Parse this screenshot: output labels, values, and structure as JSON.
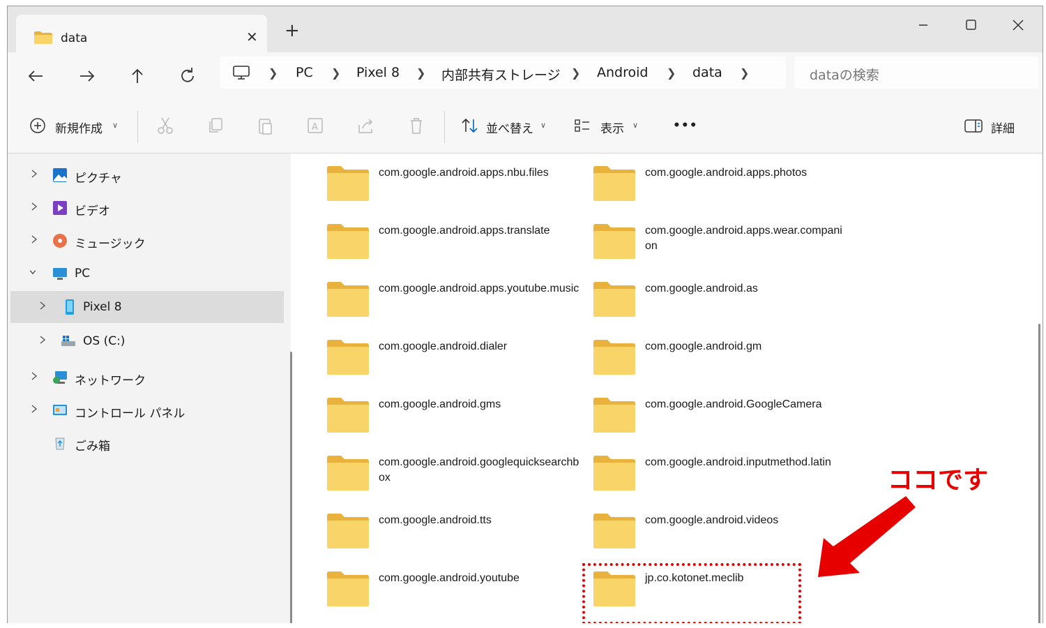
{
  "window": {
    "tab_title": "data",
    "tab_close": "✕",
    "new_tab": "+"
  },
  "breadcrumb": [
    "PC",
    "Pixel 8",
    "内部共有ストレージ",
    "Android",
    "data"
  ],
  "search": {
    "placeholder": "dataの検索"
  },
  "commandbar": {
    "new_label": "新規作成",
    "sort_label": "並べ替え",
    "view_label": "表示",
    "more_label": "•••",
    "details_label": "詳細"
  },
  "sidebar": {
    "items": [
      {
        "label": "ピクチャ",
        "icon": "pictures-icon"
      },
      {
        "label": "ビデオ",
        "icon": "videos-icon"
      },
      {
        "label": "ミュージック",
        "icon": "music-icon"
      },
      {
        "label": "PC",
        "icon": "pc-icon"
      },
      {
        "label": "Pixel 8",
        "icon": "phone-icon"
      },
      {
        "label": "OS (C:)",
        "icon": "drive-icon"
      },
      {
        "label": "ネットワーク",
        "icon": "network-icon"
      },
      {
        "label": "コントロール パネル",
        "icon": "control-panel-icon"
      },
      {
        "label": "ごみ箱",
        "icon": "recycle-bin-icon"
      }
    ]
  },
  "folders": [
    "com.google.android.apps.nbu.files",
    "com.google.android.apps.photos",
    "com.google.android.apps.translate",
    "com.google.android.apps.wear.companion",
    "com.google.android.apps.youtube.music",
    "com.google.android.as",
    "com.google.android.dialer",
    "com.google.android.gm",
    "com.google.android.gms",
    "com.google.android.GoogleCamera",
    "com.google.android.googlequicksearchbox",
    "com.google.android.inputmethod.latin",
    "com.google.android.tts",
    "com.google.android.videos",
    "com.google.android.youtube",
    "jp.co.kotonet.meclib"
  ],
  "annotation": {
    "text": "ココです",
    "color": "#e60000"
  },
  "colors": {
    "folder": "#f9d469",
    "folder_tab": "#e8b23c",
    "selected": "#dcdcdc",
    "accent": "#0067c0"
  }
}
